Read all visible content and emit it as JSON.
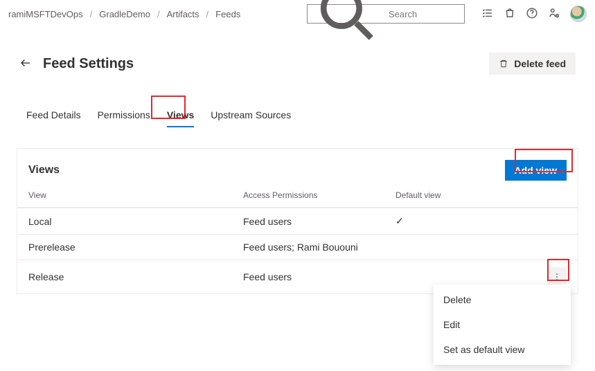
{
  "breadcrumbs": [
    "ramiMSFTDevOps",
    "GradleDemo",
    "Artifacts",
    "Feeds"
  ],
  "search": {
    "placeholder": "Search"
  },
  "page": {
    "title": "Feed Settings",
    "delete_label": "Delete feed"
  },
  "tabs": {
    "items": [
      "Feed Details",
      "Permissions",
      "Views",
      "Upstream Sources"
    ],
    "active_index": 2
  },
  "views": {
    "card_title": "Views",
    "add_label": "Add view",
    "columns": {
      "c0": "View",
      "c1": "Access Permissions",
      "c2": "Default view"
    },
    "rows": [
      {
        "name": "Local",
        "perm": "Feed users",
        "default": true
      },
      {
        "name": "Prerelease",
        "perm": "Feed users; Rami Bououni",
        "default": false
      },
      {
        "name": "Release",
        "perm": "Feed users",
        "default": false
      }
    ]
  },
  "context_menu": {
    "items": [
      "Delete",
      "Edit",
      "Set as default view"
    ]
  }
}
